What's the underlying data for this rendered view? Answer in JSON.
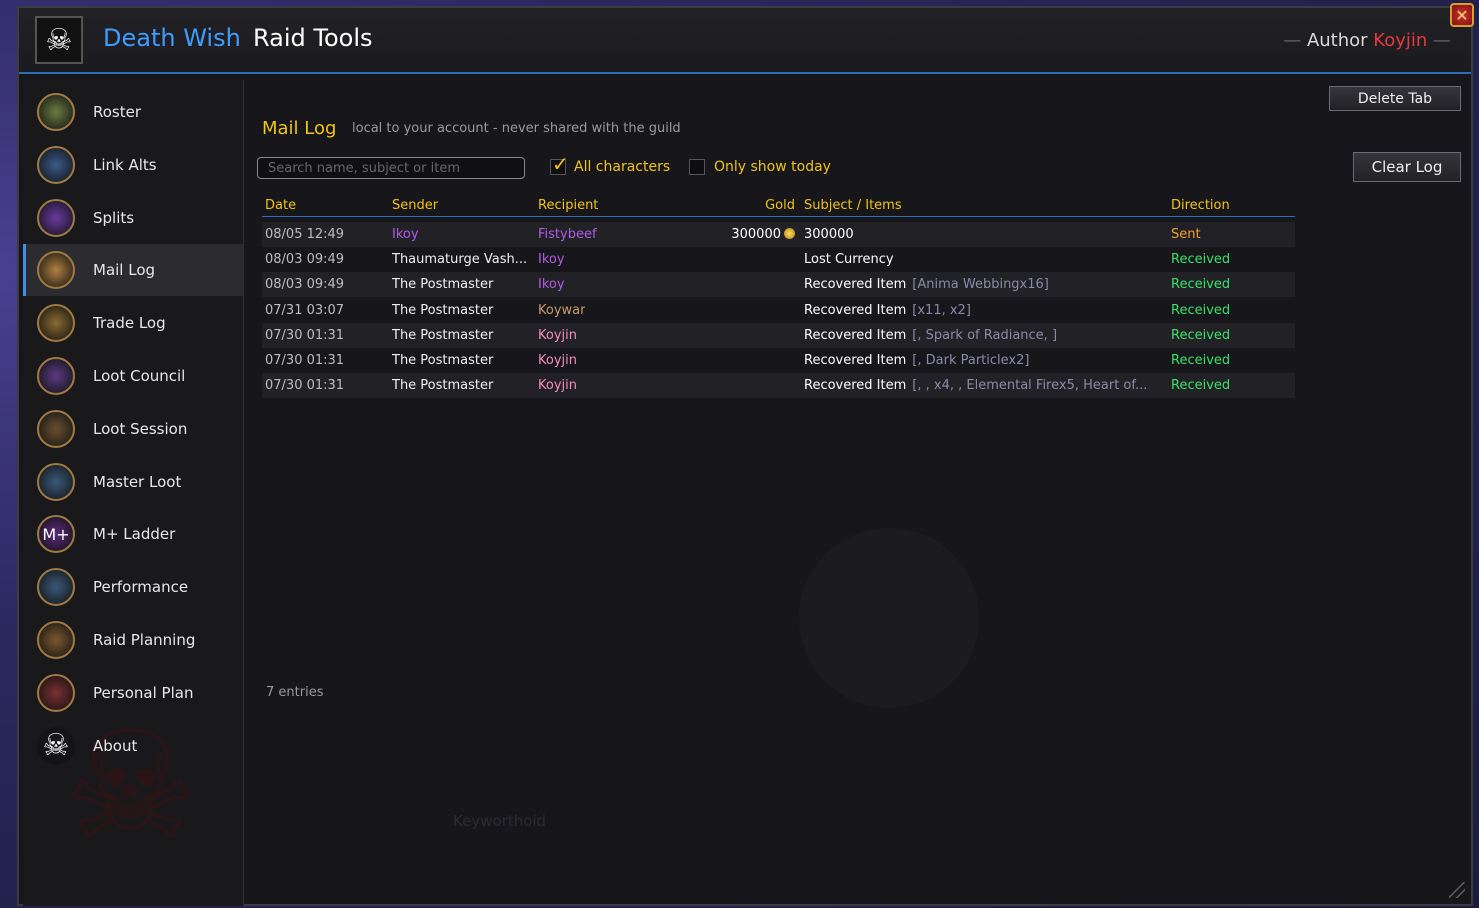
{
  "header": {
    "title_part1": "Death Wish",
    "title_part2": "Raid Tools",
    "author_label": "Author",
    "author_name": "Koyjin",
    "dash": "—",
    "close_label": "✕"
  },
  "sidebar": {
    "items": [
      {
        "label": "Roster",
        "icon": "roster-icon",
        "color": "#6a7a40"
      },
      {
        "label": "Link Alts",
        "icon": "link-alts-icon",
        "color": "#3a5a8a"
      },
      {
        "label": "Splits",
        "icon": "splits-icon",
        "color": "#6a3aa0"
      },
      {
        "label": "Mail Log",
        "icon": "mail-icon",
        "color": "#b08040"
      },
      {
        "label": "Trade Log",
        "icon": "trade-icon",
        "color": "#8a6a30"
      },
      {
        "label": "Loot Council",
        "icon": "loot-council-icon",
        "color": "#5a3a80"
      },
      {
        "label": "Loot Session",
        "icon": "loot-session-icon",
        "color": "#6a5030"
      },
      {
        "label": "Master Loot",
        "icon": "master-loot-icon",
        "color": "#3a5a7a"
      },
      {
        "label": "M+ Ladder",
        "icon": "mplus-icon",
        "color": "#5a2a7a",
        "glyph": "M+"
      },
      {
        "label": "Performance",
        "icon": "performance-icon",
        "color": "#3a5a7a"
      },
      {
        "label": "Raid Planning",
        "icon": "raid-planning-icon",
        "color": "#7a5a30"
      },
      {
        "label": "Personal Plan",
        "icon": "personal-plan-icon",
        "color": "#7a3030"
      },
      {
        "label": "About",
        "icon": "skull-icon",
        "color": "#19191c",
        "glyph": "☠"
      }
    ],
    "active_index": 3
  },
  "main": {
    "title": "Mail Log",
    "subtitle": "local to your account - never shared with the guild",
    "search_placeholder": "Search name, subject or item",
    "all_characters_label": "All characters",
    "all_characters_checked": true,
    "only_today_label": "Only show today",
    "only_today_checked": false,
    "delete_tab_label": "Delete Tab",
    "clear_log_label": "Clear Log",
    "entries_text": "7 entries",
    "faded_text": "Keyworthoid"
  },
  "table": {
    "headers": {
      "date": "Date",
      "sender": "Sender",
      "recipient": "Recipient",
      "gold": "Gold",
      "subject": "Subject / Items",
      "direction": "Direction"
    },
    "rows": [
      {
        "date": "08/05 12:49",
        "sender": "Ikoy",
        "sender_color": "#b05be8",
        "recipient": "Fistybeef",
        "recipient_color": "#b05be8",
        "gold": "300000",
        "subject": "300000",
        "items": "",
        "direction": "Sent",
        "direction_color": "#f0a030"
      },
      {
        "date": "08/03 09:49",
        "sender": "Thaumaturge Vash...",
        "sender_color": "#f0f0f0",
        "recipient": "Ikoy",
        "recipient_color": "#b05be8",
        "gold": "",
        "subject": "Lost Currency",
        "items": "",
        "direction": "Received",
        "direction_color": "#3ae06a"
      },
      {
        "date": "08/03 09:49",
        "sender": "The Postmaster",
        "sender_color": "#f0f0f0",
        "recipient": "Ikoy",
        "recipient_color": "#b05be8",
        "gold": "",
        "subject": "Recovered Item",
        "items": "[Anima Webbingx16]",
        "direction": "Received",
        "direction_color": "#3ae06a"
      },
      {
        "date": "07/31 03:07",
        "sender": "The Postmaster",
        "sender_color": "#f0f0f0",
        "recipient": "Koywar",
        "recipient_color": "#c69b6d",
        "gold": "",
        "subject": "Recovered Item",
        "items": "[x11, x2]",
        "direction": "Received",
        "direction_color": "#3ae06a"
      },
      {
        "date": "07/30 01:31",
        "sender": "The Postmaster",
        "sender_color": "#f0f0f0",
        "recipient": "Koyjin",
        "recipient_color": "#f48cba",
        "gold": "",
        "subject": "Recovered Item",
        "items": "[, Spark of Radiance, ]",
        "direction": "Received",
        "direction_color": "#3ae06a"
      },
      {
        "date": "07/30 01:31",
        "sender": "The Postmaster",
        "sender_color": "#f0f0f0",
        "recipient": "Koyjin",
        "recipient_color": "#f48cba",
        "gold": "",
        "subject": "Recovered Item",
        "items": "[, Dark Particlex2]",
        "direction": "Received",
        "direction_color": "#3ae06a"
      },
      {
        "date": "07/30 01:31",
        "sender": "The Postmaster",
        "sender_color": "#f0f0f0",
        "recipient": "Koyjin",
        "recipient_color": "#f48cba",
        "gold": "",
        "subject": "Recovered Item",
        "items": "[, , x4, , Elemental Firex5, Heart of...",
        "direction": "Received",
        "direction_color": "#3ae06a"
      }
    ]
  }
}
